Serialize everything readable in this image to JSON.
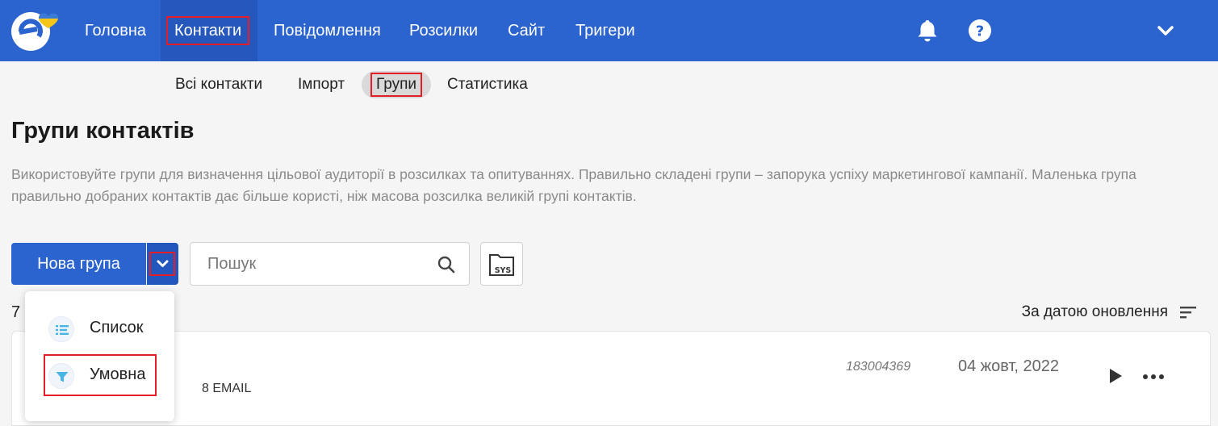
{
  "topbar": {
    "nav": [
      {
        "label": "Головна",
        "active": false
      },
      {
        "label": "Контакти",
        "active": true
      },
      {
        "label": "Повідомлення",
        "active": false
      },
      {
        "label": "Розсилки",
        "active": false
      },
      {
        "label": "Сайт",
        "active": false
      },
      {
        "label": "Тригери",
        "active": false
      }
    ],
    "icons": [
      "bell-icon",
      "help-icon",
      "chevron-down-icon"
    ]
  },
  "subnav": [
    {
      "label": "Всі контакти",
      "active": false
    },
    {
      "label": "Імпорт",
      "active": false
    },
    {
      "label": "Групи",
      "active": true
    },
    {
      "label": "Статистика",
      "active": false
    }
  ],
  "page": {
    "title": "Групи контактів",
    "description": "Використовуйте групи для визначення цільової аудиторії в розсилках та опитуваннях. Правильно складені групи – запорука успіху маркетингової кампанії. Маленька група правильно добраних контактів дає більше користі, ніж масова розсилка великій групі контактів."
  },
  "toolbar": {
    "new_group_label": "Нова група",
    "search_placeholder": "Пошук",
    "sys_label": "SYS"
  },
  "list": {
    "count": "7",
    "sort_label": "За датою оновлення"
  },
  "group_row": {
    "meta": "8 EMAIL",
    "id": "183004369",
    "date": "04 жовт, 2022"
  },
  "dropdown": {
    "items": [
      {
        "label": "Список",
        "icon": "list-icon"
      },
      {
        "label": "Умовна",
        "icon": "funnel-icon"
      }
    ]
  },
  "colors": {
    "topbar": "#2b63cf",
    "highlight": "#e41e26",
    "logo_heart_blue": "#3a7bd5",
    "logo_heart_yellow": "#f5c518"
  }
}
